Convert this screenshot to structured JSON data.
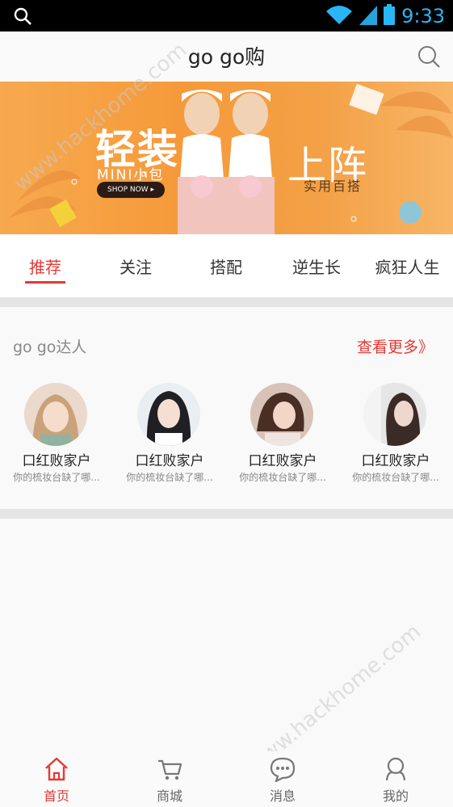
{
  "status_bar": {
    "time": "9:33"
  },
  "header": {
    "title": "go go购"
  },
  "banner": {
    "left_title": "轻装",
    "mini_label": "MINI小包",
    "shop_now": "SHOP NOW ▸",
    "right_title": "上阵",
    "right_sub": "实用百搭"
  },
  "tabs": [
    {
      "label": "推荐"
    },
    {
      "label": "关注"
    },
    {
      "label": "搭配"
    },
    {
      "label": "逆生长"
    },
    {
      "label": "疯狂人生"
    }
  ],
  "experts": {
    "title": "go go达人",
    "more": "查看更多》",
    "items": [
      {
        "name": "口红败家户",
        "desc": "你的梳妆台缺了哪..."
      },
      {
        "name": "口红败家户",
        "desc": "你的梳妆台缺了哪..."
      },
      {
        "name": "口红败家户",
        "desc": "你的梳妆台缺了哪..."
      },
      {
        "name": "口红败家户",
        "desc": "你的梳妆台缺了哪..."
      }
    ]
  },
  "bottom_nav": [
    {
      "label": "首页",
      "icon": "home-icon"
    },
    {
      "label": "商城",
      "icon": "cart-icon"
    },
    {
      "label": "消息",
      "icon": "message-icon"
    },
    {
      "label": "我的",
      "icon": "profile-icon"
    }
  ],
  "watermark": "www.hackhome.com",
  "colors": {
    "accent": "#e53935",
    "status_time": "#29b6f6"
  }
}
